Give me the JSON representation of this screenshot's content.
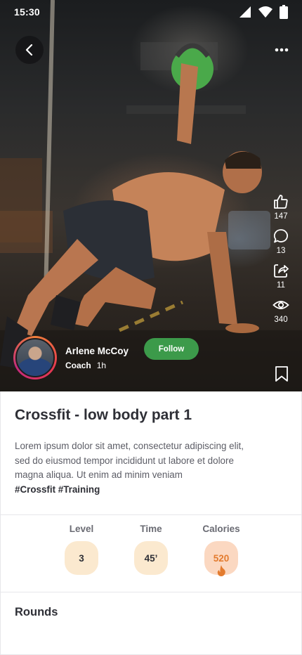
{
  "status_bar": {
    "time": "15:30"
  },
  "author": {
    "name": "Arlene McCoy",
    "role": "Coach",
    "time_ago": "1h",
    "follow_label": "Follow"
  },
  "side_actions": [
    {
      "icon": "like-icon",
      "count": "147"
    },
    {
      "icon": "comment-icon",
      "count": "13"
    },
    {
      "icon": "share-icon",
      "count": "11"
    },
    {
      "icon": "views-icon",
      "count": "340"
    },
    {
      "icon": "bookmark-icon"
    }
  ],
  "post": {
    "title": "Crossfit - low body part 1",
    "body": "Lorem ipsum dolor sit amet, consectetur adipiscing elit, sed do eiusmod tempor incididunt ut labore et dolore magna aliqua. Ut enim ad minim veniam",
    "tags": "#Crossfit #Training"
  },
  "stats": [
    {
      "label": "Level",
      "value": "3"
    },
    {
      "label": "Time",
      "value": "45’"
    },
    {
      "label": "Calories",
      "value": "520"
    }
  ],
  "sections": {
    "rounds_title": "Rounds"
  },
  "colors": {
    "follow": "#3c9a4a",
    "stat_badge": "#fbe9cf",
    "calorie_badge": "#fbd8c1",
    "calorie_accent": "#e37b2e"
  }
}
